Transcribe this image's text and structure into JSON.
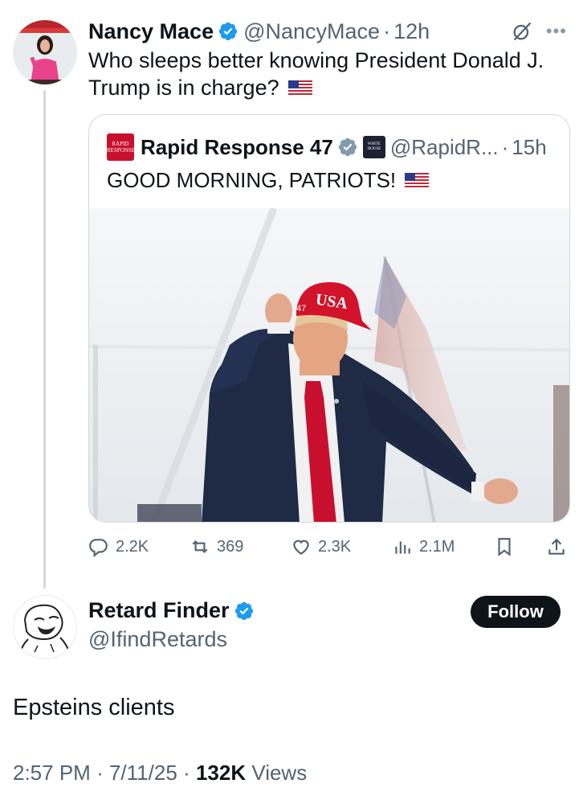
{
  "parent_tweet": {
    "author_name": "Nancy Mace",
    "handle": "@NancyMace",
    "separator": "·",
    "time": "12h",
    "text": "Who sleeps better knowing President Donald J. Trump is in charge?",
    "emoji": "us-flag"
  },
  "quoted_tweet": {
    "author_name": "Rapid Response 47",
    "logo_text_line1": "RAPID",
    "logo_text_line2": "RESPONSE",
    "badge_text_line1": "WHITE",
    "badge_text_line2": "HOUSE",
    "handle": "@RapidR...",
    "separator": "·",
    "time": "15h",
    "text": "GOOD MORNING, PATRIOTS!",
    "emoji": "us-flag",
    "image_hat_text": "USA",
    "image_hat_number": "47"
  },
  "actions": {
    "replies": "2.2K",
    "reposts": "369",
    "likes": "2.3K",
    "views": "2.1M"
  },
  "reply_tweet": {
    "author_name": "Retard Finder",
    "handle": "@IfindRetards",
    "follow_label": "Follow",
    "text": "Epsteins clients",
    "time": "2:57 PM",
    "date": "7/11/25",
    "views_count": "132K",
    "views_label": "Views",
    "separator": "·"
  },
  "colors": {
    "verified": "#1d9bf0",
    "text_primary": "#0f1419",
    "text_secondary": "#536471",
    "border": "#cfd9de",
    "follow_bg": "#0f1419",
    "rr_red": "#c8102e"
  },
  "icons": [
    "verified-badge-icon",
    "grok-icon",
    "more-icon",
    "reply-icon",
    "repost-icon",
    "like-icon",
    "views-icon",
    "bookmark-icon",
    "share-icon"
  ]
}
